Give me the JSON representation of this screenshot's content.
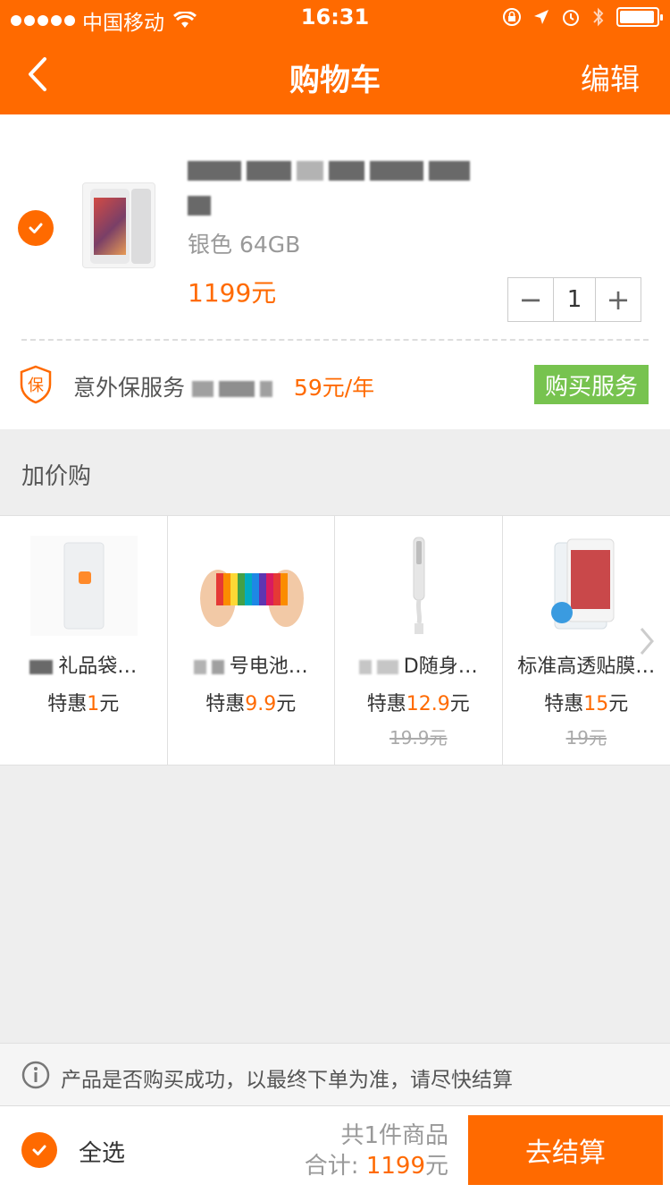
{
  "status_bar": {
    "carrier": "中国移动",
    "time": "16:31"
  },
  "nav": {
    "title": "购物车",
    "edit_label": "编辑"
  },
  "cart_item": {
    "name_line2_tail": "",
    "spec": "银色 64GB",
    "price": "1199元",
    "quantity": "1",
    "minus_label": "−",
    "plus_label": "+"
  },
  "service": {
    "icon_text": "保",
    "label": "意外保服务",
    "price": "59元/年",
    "buy_label": "购买服务"
  },
  "addon": {
    "header": "加价购",
    "items": [
      {
        "name": "礼品袋…",
        "price_prefix": "特惠",
        "price_num": "1",
        "price_unit": "元",
        "original": ""
      },
      {
        "name": "号电池…",
        "price_prefix": "特惠",
        "price_num": "9.9",
        "price_unit": "元",
        "original": ""
      },
      {
        "name": "D随身…",
        "price_prefix": "特惠",
        "price_num": "12.9",
        "price_unit": "元",
        "original": "19.9元"
      },
      {
        "name": "标准高透贴膜…",
        "price_prefix": "特惠",
        "price_num": "15",
        "price_unit": "元",
        "original": "19元"
      }
    ]
  },
  "notice": {
    "text": "产品是否购买成功，以最终下单为准，请尽快结算"
  },
  "checkout": {
    "select_all_label": "全选",
    "count_text": "共1件商品",
    "total_prefix": "合计: ",
    "total_amount": "1199",
    "total_unit": "元",
    "checkout_label": "去结算"
  },
  "colors": {
    "accent": "#ff6a00",
    "service_button": "#77c34f"
  }
}
